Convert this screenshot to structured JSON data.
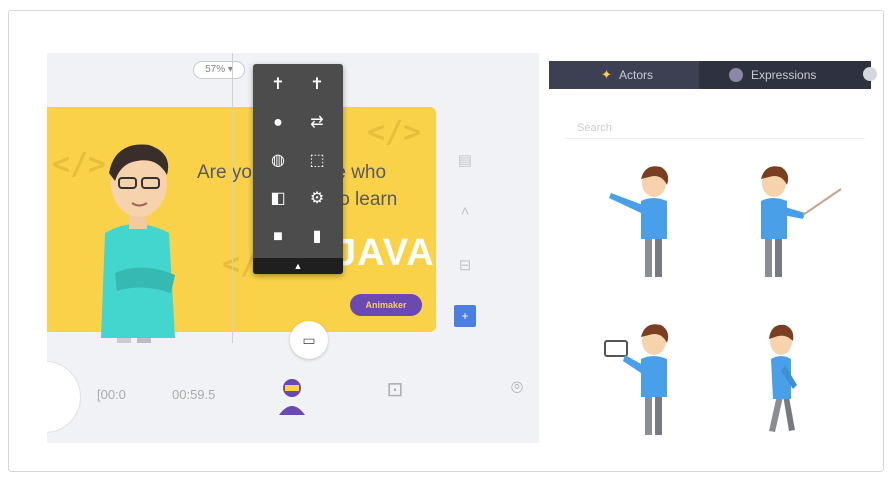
{
  "canvas": {
    "zoom": "57%",
    "slide": {
      "line1": "Are you someone who",
      "line2": "wants to learn",
      "big": "JAVA?",
      "logo": "Animaker",
      "code_glyph": "</>"
    }
  },
  "timeline": {
    "current": "[00:0",
    "end": "00:59.5"
  },
  "library": {
    "tabs": [
      {
        "label": "Actors",
        "icon": "actor-icon"
      },
      {
        "label": "Expressions",
        "icon": "expressions-icon"
      }
    ],
    "search_placeholder": "Search",
    "characters": [
      {
        "pose": "pointing"
      },
      {
        "pose": "holding-pointer-stick"
      },
      {
        "pose": "holding-laptop"
      },
      {
        "pose": "walking-side"
      }
    ]
  },
  "colors": {
    "slide_bg": "#f9d24a",
    "toolbar_bg": "#4c4c4c",
    "tab_bar_bg": "#2e3140",
    "accent_blue": "#4a7fe0",
    "character_shirt": "#4aa0e8",
    "presenter_shirt": "#43d6cf"
  }
}
